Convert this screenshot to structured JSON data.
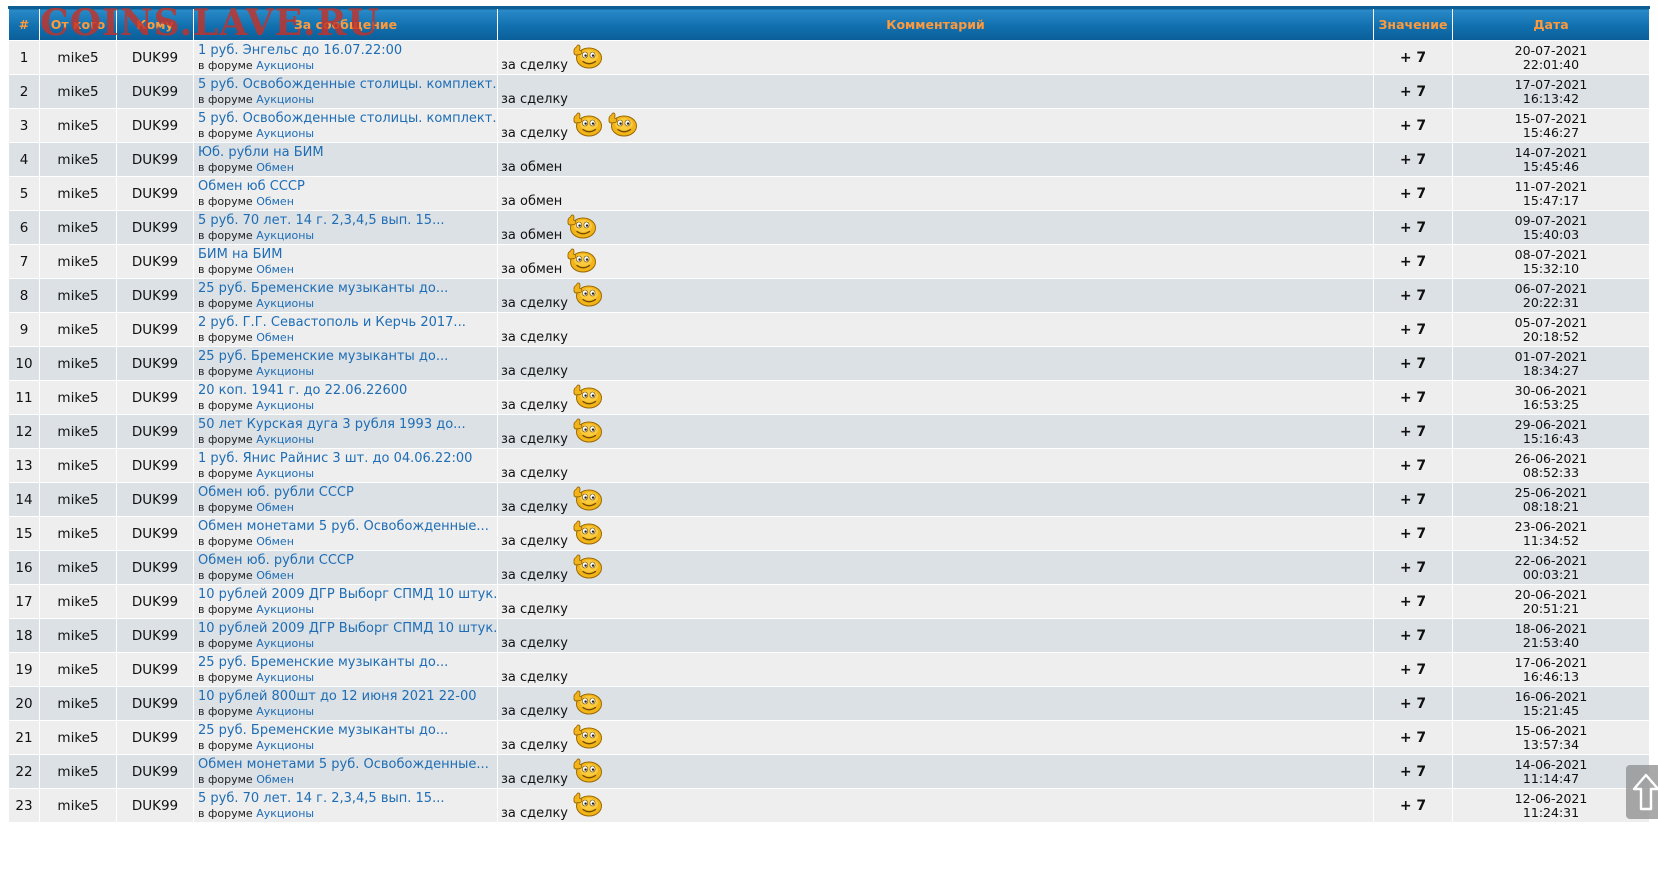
{
  "watermark": "COINS.LAVE.RU",
  "columns": {
    "num": "#",
    "from": "От кого",
    "to": "Кому",
    "post": "За сообщение",
    "comment": "Комментарий",
    "value": "Значение",
    "date": "Дата"
  },
  "forum_prefix": "в форуме",
  "rows": [
    {
      "n": "1",
      "from": "mike5",
      "to": "DUK99",
      "title": "1 руб. Энгельс до 16.07.22:00",
      "forum": "Аукционы",
      "comment": "за сделку",
      "smileys": 1,
      "value": "+ 7",
      "date": "20-07-2021",
      "time": "22:01:40"
    },
    {
      "n": "2",
      "from": "mike5",
      "to": "DUK99",
      "title": "5 руб. Освобожденные столицы. комплект...",
      "forum": "Аукционы",
      "comment": "за сделку",
      "smileys": 0,
      "value": "+ 7",
      "date": "17-07-2021",
      "time": "16:13:42"
    },
    {
      "n": "3",
      "from": "mike5",
      "to": "DUK99",
      "title": "5 руб. Освобожденные столицы. комплект...",
      "forum": "Аукционы",
      "comment": "за сделку",
      "smileys": 2,
      "value": "+ 7",
      "date": "15-07-2021",
      "time": "15:46:27"
    },
    {
      "n": "4",
      "from": "mike5",
      "to": "DUK99",
      "title": "Юб. рубли на БИМ",
      "forum": "Обмен",
      "comment": "за обмен",
      "smileys": 0,
      "value": "+ 7",
      "date": "14-07-2021",
      "time": "15:45:46"
    },
    {
      "n": "5",
      "from": "mike5",
      "to": "DUK99",
      "title": "Обмен юб СССР",
      "forum": "Обмен",
      "comment": "за обмен",
      "smileys": 0,
      "value": "+ 7",
      "date": "11-07-2021",
      "time": "15:47:17"
    },
    {
      "n": "6",
      "from": "mike5",
      "to": "DUK99",
      "title": "5 руб. 70 лет. 14 г. 2,3,4,5 вып. 15...",
      "forum": "Аукционы",
      "comment": "за обмен",
      "smileys": 1,
      "value": "+ 7",
      "date": "09-07-2021",
      "time": "15:40:03"
    },
    {
      "n": "7",
      "from": "mike5",
      "to": "DUK99",
      "title": "БИМ на БИМ",
      "forum": "Обмен",
      "comment": "за обмен",
      "smileys": 1,
      "value": "+ 7",
      "date": "08-07-2021",
      "time": "15:32:10"
    },
    {
      "n": "8",
      "from": "mike5",
      "to": "DUK99",
      "title": "25 руб. Бременские музыканты до...",
      "forum": "Аукционы",
      "comment": "за сделку",
      "smileys": 1,
      "value": "+ 7",
      "date": "06-07-2021",
      "time": "20:22:31"
    },
    {
      "n": "9",
      "from": "mike5",
      "to": "DUK99",
      "title": "2 руб. Г.Г. Севастополь и Керчь 2017...",
      "forum": "Обмен",
      "comment": "за сделку",
      "smileys": 0,
      "value": "+ 7",
      "date": "05-07-2021",
      "time": "20:18:52"
    },
    {
      "n": "10",
      "from": "mike5",
      "to": "DUK99",
      "title": "25 руб. Бременские музыканты до...",
      "forum": "Аукционы",
      "comment": "за сделку",
      "smileys": 0,
      "value": "+ 7",
      "date": "01-07-2021",
      "time": "18:34:27"
    },
    {
      "n": "11",
      "from": "mike5",
      "to": "DUK99",
      "title": "20 коп. 1941 г. до 22.06.22600",
      "forum": "Аукционы",
      "comment": "за сделку",
      "smileys": 1,
      "value": "+ 7",
      "date": "30-06-2021",
      "time": "16:53:25"
    },
    {
      "n": "12",
      "from": "mike5",
      "to": "DUK99",
      "title": "50 лет Курская дуга 3 рубля 1993 до...",
      "forum": "Аукционы",
      "comment": "за сделку",
      "smileys": 1,
      "value": "+ 7",
      "date": "29-06-2021",
      "time": "15:16:43"
    },
    {
      "n": "13",
      "from": "mike5",
      "to": "DUK99",
      "title": "1 руб. Янис Райнис 3 шт. до 04.06.22:00",
      "forum": "Аукционы",
      "comment": "за сделку",
      "smileys": 0,
      "value": "+ 7",
      "date": "26-06-2021",
      "time": "08:52:33"
    },
    {
      "n": "14",
      "from": "mike5",
      "to": "DUK99",
      "title": "Обмен юб. рубли СССР",
      "forum": "Обмен",
      "comment": "за сделку",
      "smileys": 1,
      "value": "+ 7",
      "date": "25-06-2021",
      "time": "08:18:21"
    },
    {
      "n": "15",
      "from": "mike5",
      "to": "DUK99",
      "title": "Обмен монетами 5 руб. Освобожденные...",
      "forum": "Обмен",
      "comment": "за сделку",
      "smileys": 1,
      "value": "+ 7",
      "date": "23-06-2021",
      "time": "11:34:52"
    },
    {
      "n": "16",
      "from": "mike5",
      "to": "DUK99",
      "title": "Обмен юб. рубли СССР",
      "forum": "Обмен",
      "comment": "за сделку",
      "smileys": 1,
      "value": "+ 7",
      "date": "22-06-2021",
      "time": "00:03:21"
    },
    {
      "n": "17",
      "from": "mike5",
      "to": "DUK99",
      "title": "10 рублей 2009 ДГР Выборг СПМД 10 штук...",
      "forum": "Аукционы",
      "comment": "за сделку",
      "smileys": 0,
      "value": "+ 7",
      "date": "20-06-2021",
      "time": "20:51:21"
    },
    {
      "n": "18",
      "from": "mike5",
      "to": "DUK99",
      "title": "10 рублей 2009 ДГР Выборг СПМД 10 штук...",
      "forum": "Аукционы",
      "comment": "за сделку",
      "smileys": 0,
      "value": "+ 7",
      "date": "18-06-2021",
      "time": "21:53:40"
    },
    {
      "n": "19",
      "from": "mike5",
      "to": "DUK99",
      "title": "25 руб. Бременские музыканты до...",
      "forum": "Аукционы",
      "comment": "за сделку",
      "smileys": 0,
      "value": "+ 7",
      "date": "17-06-2021",
      "time": "16:46:13"
    },
    {
      "n": "20",
      "from": "mike5",
      "to": "DUK99",
      "title": "10 рублей 800шт до 12 июня 2021 22-00",
      "forum": "Аукционы",
      "comment": "за сделку",
      "smileys": 1,
      "value": "+ 7",
      "date": "16-06-2021",
      "time": "15:21:45"
    },
    {
      "n": "21",
      "from": "mike5",
      "to": "DUK99",
      "title": "25 руб. Бременские музыканты до...",
      "forum": "Аукционы",
      "comment": "за сделку",
      "smileys": 1,
      "value": "+ 7",
      "date": "15-06-2021",
      "time": "13:57:34"
    },
    {
      "n": "22",
      "from": "mike5",
      "to": "DUK99",
      "title": "Обмен монетами 5 руб. Освобожденные...",
      "forum": "Обмен",
      "comment": "за сделку",
      "smileys": 1,
      "value": "+ 7",
      "date": "14-06-2021",
      "time": "11:14:47"
    },
    {
      "n": "23",
      "from": "mike5",
      "to": "DUK99",
      "title": "5 руб. 70 лет. 14 г. 2,3,4,5 вып. 15...",
      "forum": "Аукционы",
      "comment": "за сделку",
      "smileys": 1,
      "value": "+ 7",
      "date": "12-06-2021",
      "time": "11:24:31"
    }
  ],
  "icons": {
    "smiley": "thumbs-up-smiley-icon",
    "scroll_top": "arrow-up-icon"
  },
  "colors": {
    "header_bg": "#116fae",
    "header_text": "#ff9a3c",
    "link": "#1e6db5",
    "value_positive": "#1a7a1a",
    "row_odd": "#eeeeee",
    "row_even": "#dce1e5",
    "watermark": "#c43228"
  }
}
